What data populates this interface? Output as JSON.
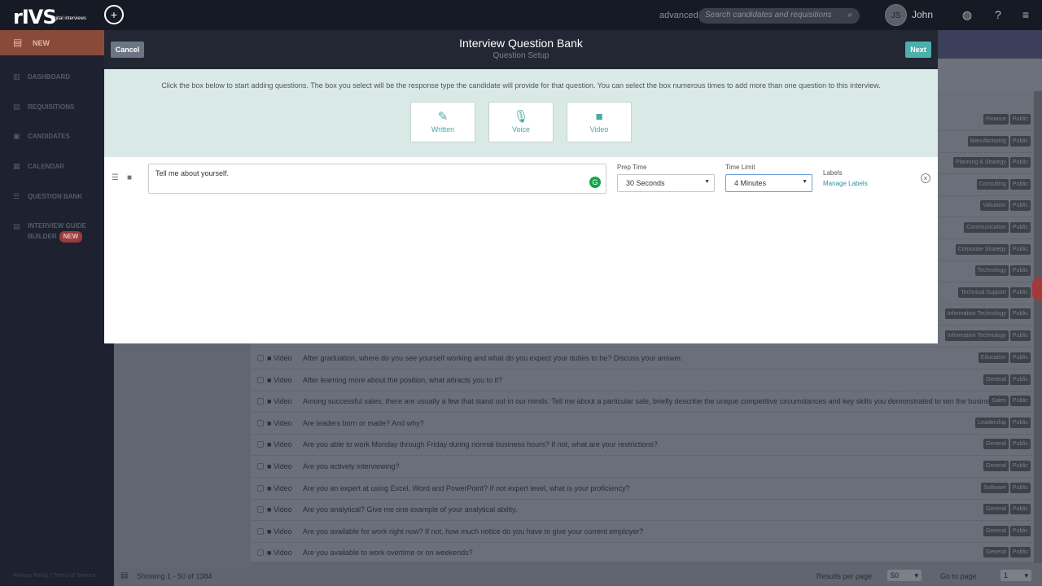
{
  "topbar": {
    "logo": "rIVS",
    "logo_sub": "digital interviews",
    "advanced_label": "advanced",
    "search_placeholder": "Search candidates and requisitions",
    "avatar_initials": "JS",
    "user_name": "John"
  },
  "sidebar": {
    "new_label": "NEW",
    "items": [
      {
        "label": "DASHBOARD",
        "icon": "chart-icon"
      },
      {
        "label": "REQUISITIONS",
        "icon": "document-icon"
      },
      {
        "label": "CANDIDATES",
        "icon": "user-icon"
      },
      {
        "label": "CALENDAR",
        "icon": "calendar-icon"
      },
      {
        "label": "QUESTION BANK",
        "icon": "list-icon"
      },
      {
        "label": "INTERVIEW GUIDE",
        "label2": "BUILDER",
        "badge": "NEW",
        "icon": "guide-icon"
      }
    ],
    "footer": "Privacy Policy | Terms of Service"
  },
  "modal": {
    "title": "Interview Question Bank",
    "subtitle": "Question Setup",
    "cancel_label": "Cancel",
    "next_label": "Next",
    "instructions": "Click the box below to start adding questions. The box you select will be the response type the candidate will provide for that question. You can select the box numerous times to add more than one question to this interview.",
    "response_types": [
      {
        "label": "Written",
        "icon": "pencil-icon",
        "glyph": "✎"
      },
      {
        "label": "Voice",
        "icon": "microphone-icon",
        "glyph": "🎙"
      },
      {
        "label": "Video",
        "icon": "video-camera-icon",
        "glyph": "■"
      }
    ],
    "question": {
      "text": "Tell me about yourself.",
      "prep_time_label": "Prep Time",
      "prep_time_value": "30 Seconds",
      "time_limit_label": "Time Limit",
      "time_limit_value": "4 Minutes",
      "labels_label": "Labels",
      "manage_labels": "Manage Labels"
    }
  },
  "background_list": {
    "type_label": "Video",
    "upper_tags": [
      [
        "Finance",
        "Public"
      ],
      [
        "Manufacturing",
        "Public"
      ],
      [
        "Planning & Strategy",
        "Public"
      ],
      [
        "Consulting",
        "Public"
      ],
      [
        "Valuation",
        "Public"
      ],
      [
        "Communication",
        "Public"
      ],
      [
        "Corporate Strategy",
        "Public"
      ],
      [
        "Technology",
        "Public"
      ],
      [
        "Technical Support",
        "Public"
      ],
      [
        "Information Technology",
        "Public"
      ],
      [
        "Information Technology",
        "Public"
      ]
    ],
    "rows": [
      {
        "q": "After graduation, where do you see yourself working and what do you expect your duties to be? Discuss your answer.",
        "tag": "Education",
        "vis": "Public"
      },
      {
        "q": "After learning more about the position, what attracts you to it?",
        "tag": "General",
        "vis": "Public"
      },
      {
        "q": "Among successful sales, there are usually a few that stand out in our minds. Tell me about a particular sale, briefly describe the unique competitive circumstances and key skills you demonstrated to win the business.",
        "tag": "Sales",
        "vis": "Public"
      },
      {
        "q": "Are leaders born or made? And why?",
        "tag": "Leadership",
        "vis": "Public"
      },
      {
        "q": "Are you able to work Monday through Friday during normal business hours? If not, what are your restrictions?",
        "tag": "General",
        "vis": "Public"
      },
      {
        "q": "Are you actively interviewing?",
        "tag": "General",
        "vis": "Public"
      },
      {
        "q": "Are you an expert at using Excel, Word and PowerPoint? If not expert level, what is your proficiency?",
        "tag": "Software",
        "vis": "Public"
      },
      {
        "q": "Are you analytical? Give me one example of your analytical ability.",
        "tag": "General",
        "vis": "Public"
      },
      {
        "q": "Are you available for work right now? If not, how much notice do you have to give your current employer?",
        "tag": "General",
        "vis": "Public"
      },
      {
        "q": "Are you available to work overtime or on weekends?",
        "tag": "General",
        "vis": "Public"
      }
    ],
    "footer": {
      "showing": "Showing 1 - 50 of 1384",
      "results_label": "Results per page",
      "results_value": "50",
      "goto_label": "Go to page",
      "goto_value": "1"
    }
  }
}
